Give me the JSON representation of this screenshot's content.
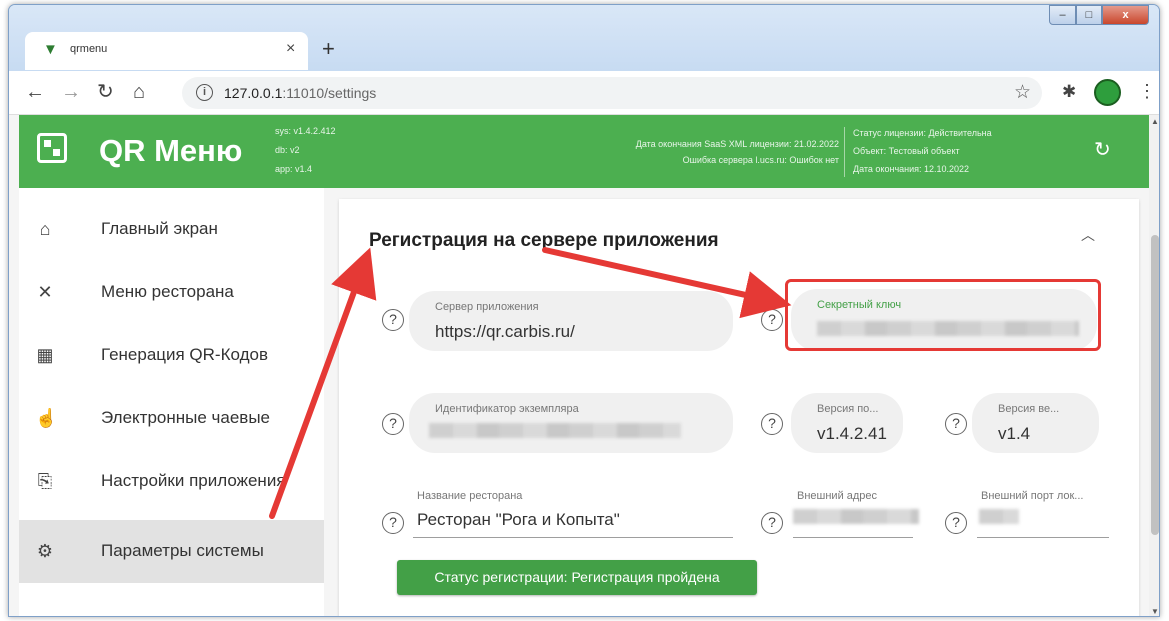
{
  "browser": {
    "tab_title": "qrmenu",
    "tab_close": "×",
    "new_tab": "+",
    "url_host": "127.0.0.1",
    "url_path": ":11010/settings",
    "window_controls": {
      "minimize": "–",
      "maximize": "□",
      "close": "x"
    }
  },
  "header": {
    "brand": "QR Меню",
    "versions": [
      "sys: v1.4.2.412",
      "db: v2",
      "app: v1.4"
    ],
    "saas_info": [
      "Дата окончания SaaS XML лицензии: 21.02.2022",
      "Ошибка сервера l.ucs.ru: Ошибок нет"
    ],
    "license_info": [
      "Статус лицензии: Действительна",
      "Объект: Тестовый объект",
      "Дата окончания: 12.10.2022"
    ]
  },
  "sidebar": {
    "items": [
      {
        "label": "Главный экран",
        "icon": "home-icon",
        "glyph": "⌂"
      },
      {
        "label": "Меню ресторана",
        "icon": "cutlery-icon",
        "glyph": "✕"
      },
      {
        "label": "Генерация QR-Кодов",
        "icon": "qr-code-icon",
        "glyph": "▦"
      },
      {
        "label": "Электронные чаевые",
        "icon": "tips-hand-icon",
        "glyph": "☝"
      },
      {
        "label": "Настройки приложения",
        "icon": "app-settings-icon",
        "glyph": "⎘"
      },
      {
        "label": "Параметры системы",
        "icon": "gear-icon",
        "glyph": "⚙"
      }
    ]
  },
  "section": {
    "title": "Регистрация на сервере приложения",
    "fields": {
      "server": {
        "label": "Сервер приложения",
        "value": "https://qr.carbis.ru/"
      },
      "secret": {
        "label": "Секретный ключ"
      },
      "instance": {
        "label": "Идентификатор экземпляра"
      },
      "version_po": {
        "label": "Версия по...",
        "value": "v1.4.2.41"
      },
      "version_ve": {
        "label": "Версия ве...",
        "value": "v1.4"
      },
      "restaurant": {
        "label": "Название ресторана",
        "value": "Ресторан \"Рога и Копыта\""
      },
      "external_address": {
        "label": "Внешний адрес"
      },
      "external_port": {
        "label": "Внешний порт лок..."
      }
    },
    "status_button": "Статус регистрации: Регистрация пройдена"
  },
  "colors": {
    "accent_green": "#4caf50",
    "highlight_red": "#e53935"
  }
}
